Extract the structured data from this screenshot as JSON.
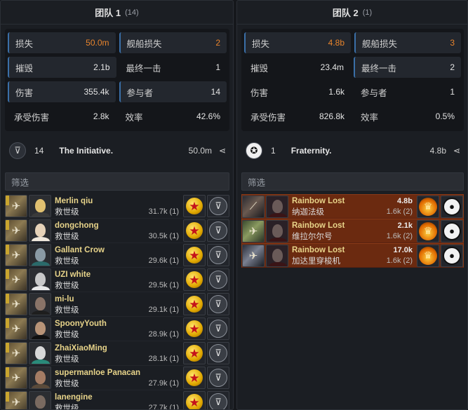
{
  "team1": {
    "title": "团队 1",
    "count": "(14)",
    "stats": [
      {
        "label": "损失",
        "value": "50.0m",
        "accent": true
      },
      {
        "label": "舰船损失",
        "value": "2",
        "accent": true
      },
      {
        "label": "摧毁",
        "value": "2.1b",
        "accent": false
      },
      {
        "label": "最终一击",
        "value": "1",
        "accent": false
      },
      {
        "label": "伤害",
        "value": "355.4k",
        "accent": false
      },
      {
        "label": "参与者",
        "value": "14",
        "accent": false
      },
      {
        "label": "承受伤害",
        "value": "2.8k",
        "accent": false
      },
      {
        "label": "效率",
        "value": "42.6%",
        "accent": false
      }
    ],
    "corp": {
      "count": "14",
      "name": "The Initiative.",
      "isk": "50.0m",
      "logo_icon": "initiative-logo-icon"
    },
    "filter_placeholder": "筛选",
    "pilots": [
      {
        "name": "Merlin qiu",
        "ship": "救世级",
        "damage": "31.7k (1)",
        "face": "#e0c070",
        "body": "#3a3a3a"
      },
      {
        "name": "dongchong",
        "ship": "救世级",
        "damage": "30.5k (1)",
        "face": "#e6d2b8",
        "body": "#f0e8dc"
      },
      {
        "name": "Gallant Crow",
        "ship": "救世级",
        "damage": "29.6k (1)",
        "face": "#8a9aa4",
        "body": "#2a6a6a"
      },
      {
        "name": "UZI white",
        "ship": "救世级",
        "damage": "29.5k (1)",
        "face": "#c8c8c8",
        "body": "#e8e8e8"
      },
      {
        "name": "mi-lu",
        "ship": "救世级",
        "damage": "29.1k (1)",
        "face": "#8a7468",
        "body": "#1e1e1e"
      },
      {
        "name": "SpoonyYouth",
        "ship": "救世级",
        "damage": "28.9k (1)",
        "face": "#b89478",
        "body": "#101010"
      },
      {
        "name": "ZhaiXiaoMing",
        "ship": "救世级",
        "damage": "28.1k (1)",
        "face": "#d8d8d8",
        "body": "#2a8a7a"
      },
      {
        "name": "supermanloe Panacan",
        "ship": "救世级",
        "damage": "27.9k (1)",
        "face": "#a47c64",
        "body": "#5a4a3a"
      },
      {
        "name": "lanengine",
        "ship": "救世级",
        "damage": "27.7k (1)",
        "face": "#7a6a60",
        "body": "#2a2a2a"
      }
    ]
  },
  "team2": {
    "title": "团队 2",
    "count": "(1)",
    "stats": [
      {
        "label": "损失",
        "value": "4.8b",
        "accent": true
      },
      {
        "label": "舰船损失",
        "value": "3",
        "accent": true
      },
      {
        "label": "摧毁",
        "value": "23.4m",
        "accent": false
      },
      {
        "label": "最终一击",
        "value": "2",
        "accent": false
      },
      {
        "label": "伤害",
        "value": "1.6k",
        "accent": false
      },
      {
        "label": "参与者",
        "value": "1",
        "accent": false
      },
      {
        "label": "承受伤害",
        "value": "826.8k",
        "accent": false
      },
      {
        "label": "效率",
        "value": "0.5%",
        "accent": false
      }
    ],
    "corp": {
      "count": "1",
      "name": "Fraternity.",
      "isk": "4.8b",
      "logo_icon": "fraternity-logo-icon"
    },
    "filter_placeholder": "筛选",
    "losses": [
      {
        "name": "Rainbow Lost",
        "ship": "纳迦法级",
        "value": "4.8b",
        "damage": "1.6k (2)"
      },
      {
        "name": "Rainbow Lost",
        "ship": "维拉尔尔号",
        "value": "2.1k",
        "damage": "1.6k (2)"
      },
      {
        "name": "Rainbow Lost",
        "ship": "加达里穿梭机",
        "value": "17.0k",
        "damage": "1.6k (2)"
      }
    ]
  },
  "colors": {
    "accent_orange": "#e8842c",
    "highlight_blue": "#3a6fa8",
    "loss_row": "#6b2a10",
    "pilot_name": "#e8d48a"
  }
}
